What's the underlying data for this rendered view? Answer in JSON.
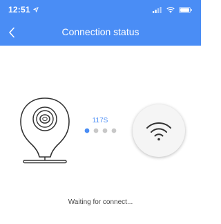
{
  "status_bar": {
    "time": "12:51",
    "location_icon": "location-arrow-icon",
    "signal_icon": "cellular-signal-icon",
    "wifi_icon": "wifi-status-icon",
    "battery_icon": "battery-icon"
  },
  "nav": {
    "title": "Connection status",
    "back_icon": "chevron-left-icon"
  },
  "connection": {
    "counter": "117S",
    "progress_dots_total": 4,
    "progress_dots_active": 1,
    "device_icon": "camera-icon",
    "network_icon": "wifi-icon"
  },
  "message": "Waiting for connect...",
  "colors": {
    "accent": "#4a8df5",
    "dot_active": "#4a8df5",
    "dot_inactive": "#c8c8c8",
    "header_bg": "#4a8df5"
  }
}
